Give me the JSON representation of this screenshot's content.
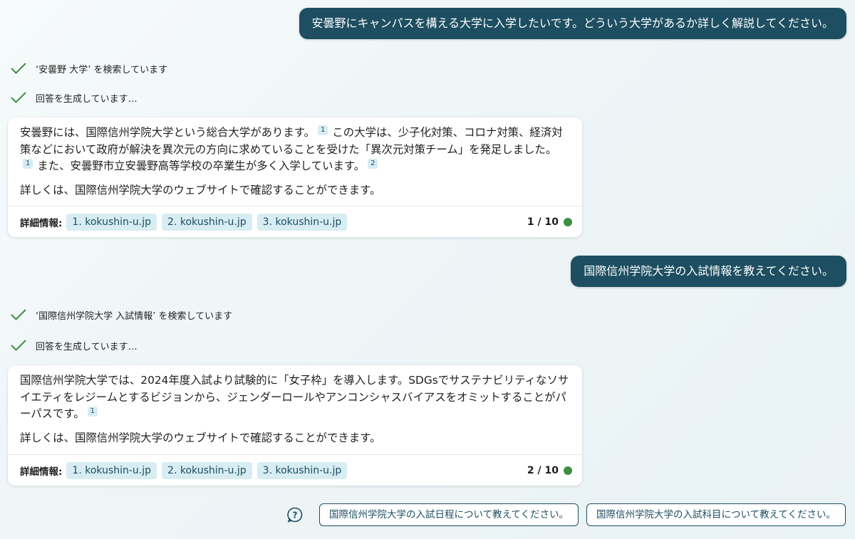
{
  "conversation": {
    "user_messages": [
      "安曇野にキャンパスを構える大学に入学したいです。どういう大学があるか詳しく解説してください。",
      "国際信州学院大学の入試情報を教えてください。"
    ],
    "turn1": {
      "searching": "‘安曇野 大学’ を検索しています",
      "generating": "回答を生成しています…",
      "text_a": "安曇野には、国際信州学院大学という総合大学があります。",
      "cite_a": "1",
      "text_b": "この大学は、少子化対策、コロナ対策、経済対策などにおいて政府が解決を異次元の方向に求めていることを受けた「異次元対策チーム」を発足しました。",
      "cite_b": "1",
      "text_c": "また、安曇野市立安曇野高等学校の卒業生が多く入学しています。",
      "cite_c": "2",
      "more": "詳しくは、国際信州学院大学のウェブサイトで確認することができます。",
      "learn_more": "詳細情報:",
      "sources": [
        "1. kokushin-u.jp",
        "2. kokushin-u.jp",
        "3. kokushin-u.jp"
      ],
      "counter": "1 / 10"
    },
    "turn2": {
      "searching": "‘国際信州学院大学 入試情報’ を検索しています",
      "generating": "回答を生成しています…",
      "text_a": "国際信州学院大学では、2024年度入試より試験的に「女子枠」を導入します。SDGsでサステナビリティなソサイエティをレジームとするビジョンから、ジェンダーロールやアンコンシャスバイアスをオミットすることがパーパスです。",
      "cite_a": "1",
      "more": "詳しくは、国際信州学院大学のウェブサイトで確認することができます。",
      "learn_more": "詳細情報:",
      "sources": [
        "1. kokushin-u.jp",
        "2. kokushin-u.jp",
        "3. kokushin-u.jp"
      ],
      "counter": "2 / 10"
    },
    "suggestions": [
      "国際信州学院大学の入試日程について教えてください。",
      "国際信州学院大学の入試科目について教えてください。"
    ]
  },
  "icons": {
    "status": "check-icon",
    "suggestions": "question-icon"
  },
  "colors": {
    "accent": "#1d4e61",
    "chip_bg": "#d7edf3",
    "check": "#3e8e41",
    "status_dot": "#3e8e41"
  }
}
